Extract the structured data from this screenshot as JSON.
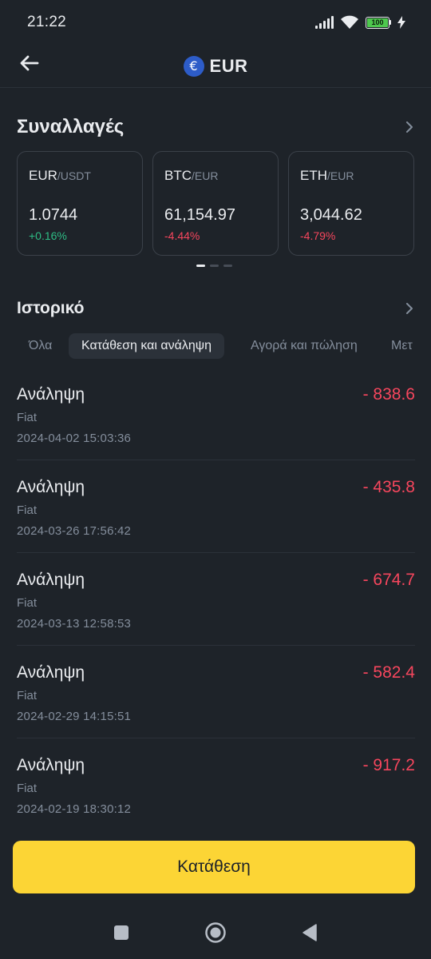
{
  "status_bar": {
    "time": "21:22",
    "battery": "100",
    "icons": [
      "signal-icon",
      "wifi-icon",
      "battery-icon",
      "charging-icon"
    ]
  },
  "header": {
    "currency_symbol": "€",
    "title": "EUR",
    "back_icon": "arrow-left-icon"
  },
  "trades": {
    "title": "Συναλλαγές",
    "cards": [
      {
        "base": "EUR",
        "quote": "/USDT",
        "price": "1.0744",
        "change": "+0.16%",
        "direction": "up"
      },
      {
        "base": "BTC",
        "quote": "/EUR",
        "price": "61,154.97",
        "change": "-4.44%",
        "direction": "down"
      },
      {
        "base": "ETH",
        "quote": "/EUR",
        "price": "3,044.62",
        "change": "-4.79%",
        "direction": "down"
      }
    ],
    "pagination": {
      "pages": 3,
      "active": 1
    }
  },
  "history": {
    "title": "Ιστορικό",
    "tabs": [
      {
        "label": "Όλα",
        "active": false
      },
      {
        "label": "Κατάθεση και ανάληψη",
        "active": true
      },
      {
        "label": "Αγορά και πώληση",
        "active": false
      },
      {
        "label": "Μετ",
        "active": false
      }
    ],
    "transactions": [
      {
        "type": "Ανάληψη",
        "category": "Fiat",
        "datetime": "2024-04-02 15:03:36",
        "amount": "- 838.6"
      },
      {
        "type": "Ανάληψη",
        "category": "Fiat",
        "datetime": "2024-03-26 17:56:42",
        "amount": "- 435.8"
      },
      {
        "type": "Ανάληψη",
        "category": "Fiat",
        "datetime": "2024-03-13 12:58:53",
        "amount": "- 674.7"
      },
      {
        "type": "Ανάληψη",
        "category": "Fiat",
        "datetime": "2024-02-29 14:15:51",
        "amount": "- 582.4"
      },
      {
        "type": "Ανάληψη",
        "category": "Fiat",
        "datetime": "2024-02-19 18:30:12",
        "amount": "- 917.2"
      }
    ]
  },
  "deposit_button": {
    "label": "Κατάθεση"
  },
  "colors": {
    "background": "#1e2329",
    "accent": "#fcd535",
    "positive": "#2ebd85",
    "negative": "#f6465d"
  }
}
